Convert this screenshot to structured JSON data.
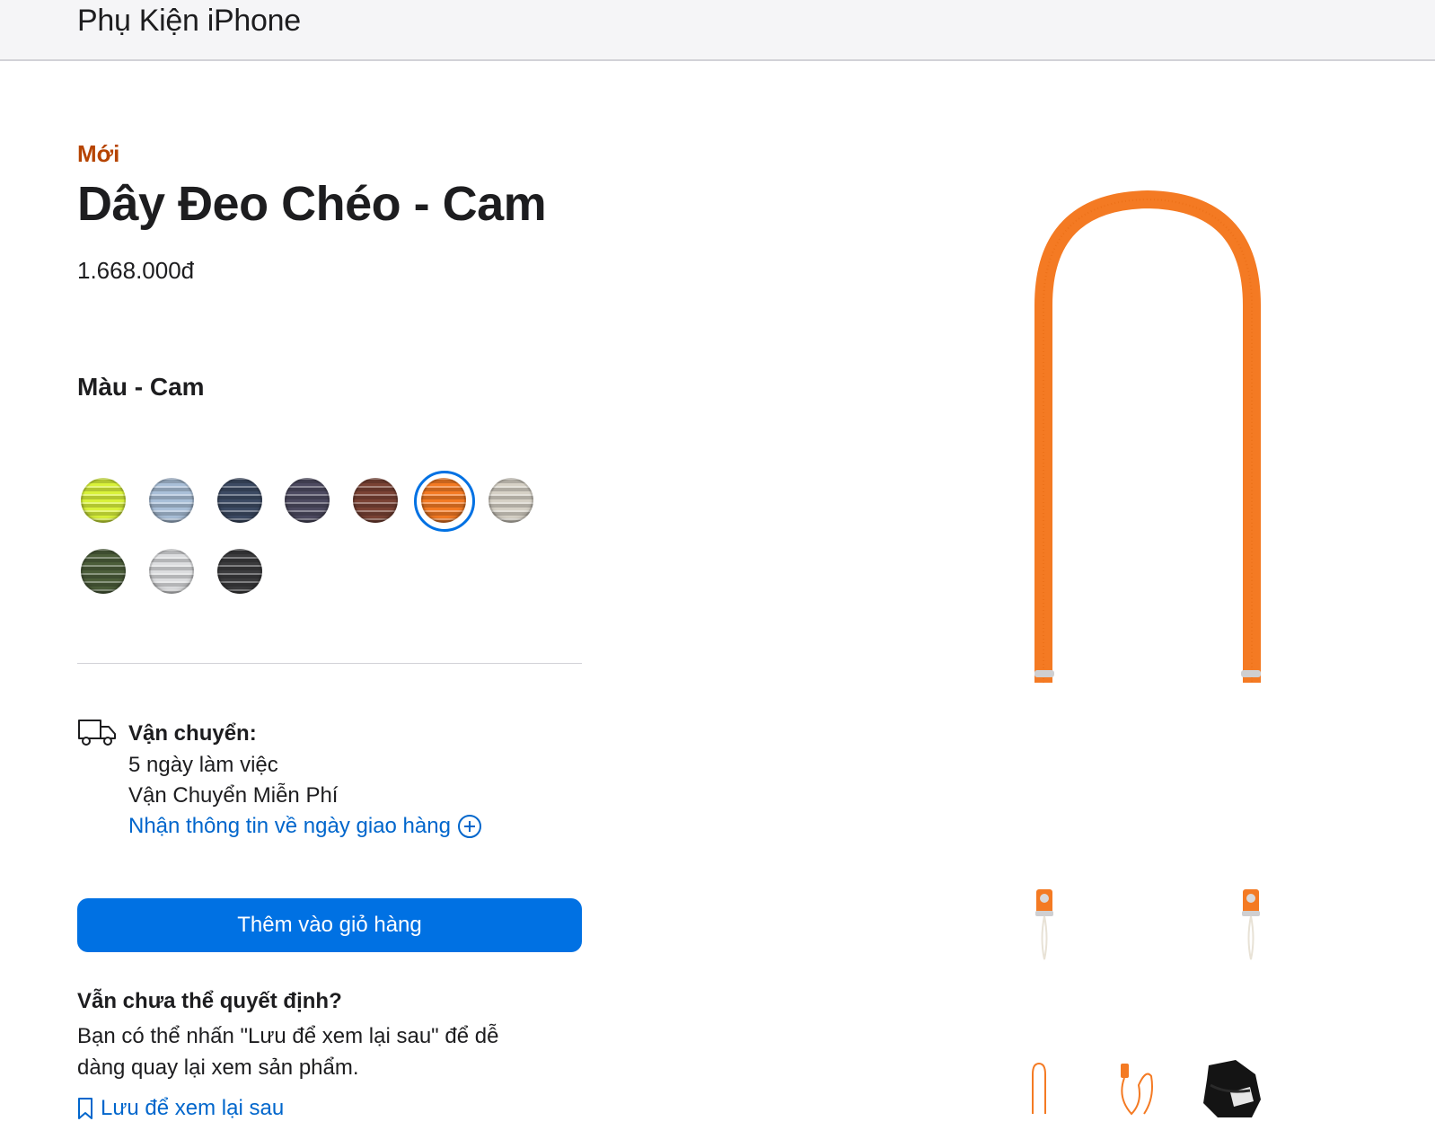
{
  "header": {
    "title": "Phụ Kiện iPhone"
  },
  "product": {
    "badge": "Mới",
    "title": "Dây Đeo Chéo - Cam",
    "price": "1.668.000đ",
    "color_label": "Màu - Cam",
    "colors": [
      {
        "name": "yellow-green",
        "hex": "#d9f23a",
        "selected": false
      },
      {
        "name": "light-blue",
        "hex": "#a9bfd8",
        "selected": false
      },
      {
        "name": "navy",
        "hex": "#3c4a63",
        "selected": false
      },
      {
        "name": "purple-gray",
        "hex": "#4d4a60",
        "selected": false
      },
      {
        "name": "brown",
        "hex": "#7a4234",
        "selected": false
      },
      {
        "name": "orange",
        "hex": "#f47a23",
        "selected": true
      },
      {
        "name": "beige",
        "hex": "#d6d1c6",
        "selected": false
      },
      {
        "name": "green",
        "hex": "#4c5e3a",
        "selected": false
      },
      {
        "name": "light-gray",
        "hex": "#dcdddf",
        "selected": false
      },
      {
        "name": "black",
        "hex": "#3b3b3d",
        "selected": false
      }
    ]
  },
  "shipping": {
    "heading": "Vận chuyển:",
    "line1": "5 ngày làm việc",
    "line2": "Vận Chuyển Miễn Phí",
    "link": "Nhận thông tin về ngày giao hàng"
  },
  "cart": {
    "add_label": "Thêm vào giỏ hàng"
  },
  "undecided": {
    "title": "Vẫn chưa thể quyết định?",
    "text": "Bạn có thể nhấn \"Lưu để xem lại sau\" để dễ dàng quay lại xem sản phẩm.",
    "save_link": "Lưu để xem lại sau"
  },
  "media": {
    "strap_color": "#f47a23",
    "accent": "#0071e3",
    "link_color": "#0066cc"
  }
}
